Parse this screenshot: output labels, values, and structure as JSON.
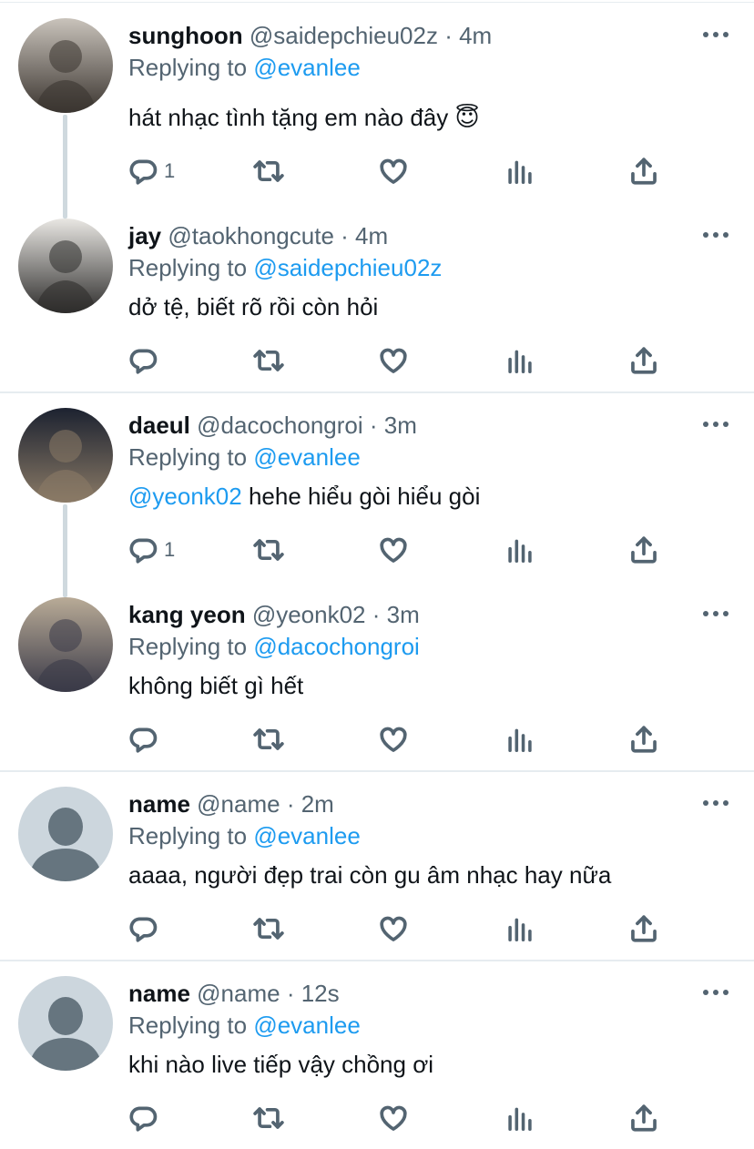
{
  "tweets": [
    {
      "display_name": "sunghoon",
      "handle": "@saidepchieu02z",
      "time": "· 4m",
      "replying_prefix": "Replying to",
      "replying_to": "@evanlee",
      "text": "hát nhạc tình tặng em nào đây 😇",
      "text_mention": "",
      "reply_count": "1",
      "avatar_colors": [
        "#c9c3bb",
        "#3b3530"
      ]
    },
    {
      "display_name": "jay",
      "handle": "@taokhongcute",
      "time": "· 4m",
      "replying_prefix": "Replying to",
      "replying_to": "@saidepchieu02z",
      "text": "dở tệ, biết rõ rồi còn hỏi",
      "text_mention": "",
      "reply_count": "",
      "avatar_colors": [
        "#e9e7e3",
        "#2e2d2c"
      ]
    },
    {
      "display_name": "daeul",
      "handle": "@dacochongroi",
      "time": "· 3m",
      "replying_prefix": "Replying to",
      "replying_to": "@evanlee",
      "text": "hehe hiểu gòi hiểu gòi",
      "text_mention": "@yeonk02",
      "reply_count": "1",
      "avatar_colors": [
        "#1c2230",
        "#8a7a66"
      ]
    },
    {
      "display_name": "kang yeon",
      "handle": "@yeonk02",
      "time": "· 3m",
      "replying_prefix": "Replying to",
      "replying_to": "@dacochongroi",
      "text": "không biết gì hết",
      "text_mention": "",
      "reply_count": "",
      "avatar_colors": [
        "#b9ab97",
        "#3a3a48"
      ]
    },
    {
      "display_name": "name",
      "handle": "@name",
      "time": "· 2m",
      "replying_prefix": "Replying to",
      "replying_to": "@evanlee",
      "text": "aaaa, người đẹp trai còn gu âm nhạc hay nữa",
      "text_mention": "",
      "reply_count": "",
      "avatar_colors": [
        "#ccd6dd",
        "#66757f"
      ]
    },
    {
      "display_name": "name",
      "handle": "@name",
      "time": "· 12s",
      "replying_prefix": "Replying to",
      "replying_to": "@evanlee",
      "text": "khi nào live tiếp vậy chồng ơi",
      "text_mention": "",
      "reply_count": "",
      "avatar_colors": [
        "#ccd6dd",
        "#66757f"
      ]
    }
  ],
  "icons": {
    "more": "more-horizontal-icon",
    "reply": "reply-bubble-icon",
    "retweet": "retweet-icon",
    "like": "heart-icon",
    "analytics": "bar-chart-icon",
    "share": "share-upload-icon"
  },
  "colors": {
    "mention": "#1d9bf0",
    "secondary_text": "#536471",
    "primary_text": "#0f1419",
    "divider": "#e6ecf0",
    "thread_line": "#cfd9de"
  }
}
